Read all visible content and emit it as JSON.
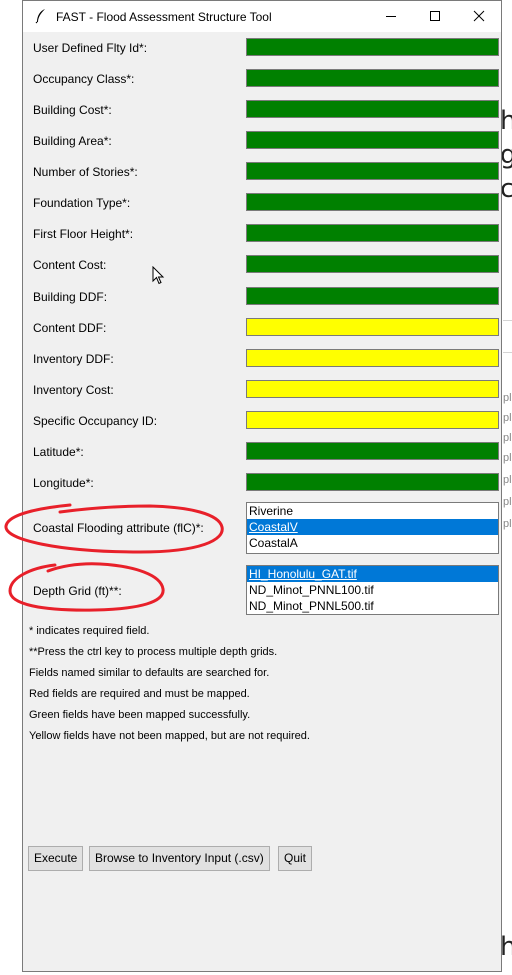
{
  "window": {
    "title": "FAST - Flood Assessment Structure Tool",
    "controls": [
      "minimize",
      "maximize",
      "close"
    ]
  },
  "colors": {
    "mapped": "#008000",
    "not_mapped": "#ffff00",
    "required_unmapped": "#ff0000",
    "selection": "#0078d7",
    "annotation": "#e8202a"
  },
  "fields": [
    {
      "label": "User Defined Flty Id*:",
      "status": "mapped"
    },
    {
      "label": "Occupancy Class*:",
      "status": "mapped"
    },
    {
      "label": "Building Cost*:",
      "status": "mapped"
    },
    {
      "label": "Building Area*:",
      "status": "mapped"
    },
    {
      "label": "Number of Stories*:",
      "status": "mapped"
    },
    {
      "label": "Foundation Type*:",
      "status": "mapped"
    },
    {
      "label": "First Floor Height*:",
      "status": "mapped"
    },
    {
      "label": "Content Cost:",
      "status": "mapped"
    },
    {
      "label": "Building DDF:",
      "status": "mapped"
    },
    {
      "label": "Content DDF:",
      "status": "not_mapped"
    },
    {
      "label": "Inventory DDF:",
      "status": "not_mapped"
    },
    {
      "label": "Inventory Cost:",
      "status": "not_mapped"
    },
    {
      "label": "Specific Occupancy ID:",
      "status": "not_mapped"
    },
    {
      "label": "Latitude*:",
      "status": "mapped"
    },
    {
      "label": "Longitude*:",
      "status": "mapped"
    }
  ],
  "coastal": {
    "label": "Coastal Flooding attribute (flC)*:",
    "options": [
      "Riverine",
      "CoastalV",
      "CoastalA"
    ],
    "selected": "CoastalV"
  },
  "depth_grid": {
    "label": "Depth Grid (ft)**:",
    "options": [
      "HI_Honolulu_GAT.tif",
      "ND_Minot_PNNL100.tif",
      "ND_Minot_PNNL500.tif"
    ],
    "selected": "HI_Honolulu_GAT.tif"
  },
  "notes": [
    "* indicates required field.",
    "**Press the ctrl key to process multiple depth grids.",
    "Fields named similar to defaults are searched for.",
    "Red fields are required and must be mapped.",
    "Green fields have been mapped successfully.",
    "Yellow fields have not been mapped, but are not required."
  ],
  "buttons": {
    "execute": "Execute",
    "browse": "Browse to Inventory Input (.csv)",
    "quit": "Quit"
  },
  "background": {
    "glyphs": [
      "h",
      "g",
      "c",
      "h"
    ],
    "side_text": [
      "pl",
      "pl",
      "pl",
      "pl",
      "pl",
      "pl",
      "pl"
    ]
  }
}
